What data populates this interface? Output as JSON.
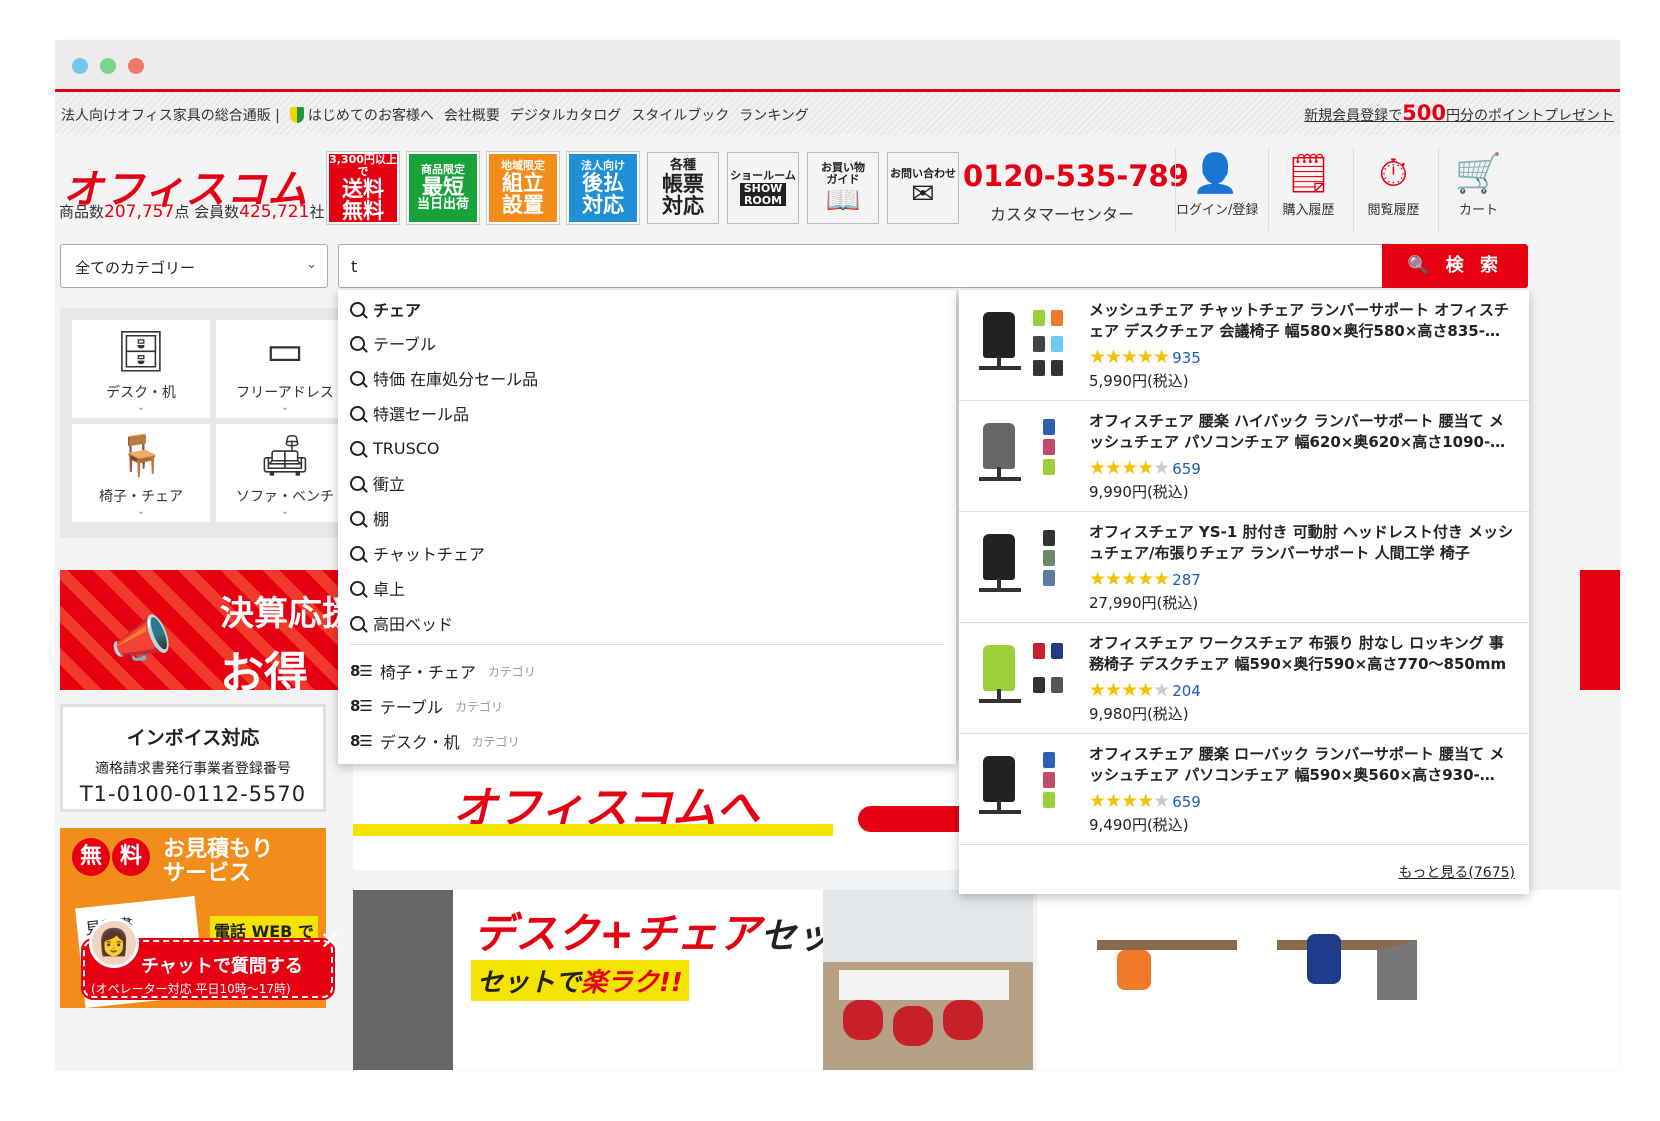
{
  "topnav": {
    "items": [
      "法人向けオフィス家具の総合通販 |",
      "はじめてのお客様へ",
      "会社概要",
      "デジタルカタログ",
      "スタイルブック",
      "ランキング"
    ],
    "promo_pre": "新規会員登録で",
    "promo_num": "500",
    "promo_post": "円分のポイントプレゼント"
  },
  "header": {
    "logo": "オフィスコム",
    "counts_label1": "商品数",
    "counts_num1": "207,757",
    "counts_unit1": "点",
    "counts_label2": "会員数",
    "counts_num2": "425,721",
    "counts_unit2": "社",
    "badges": [
      {
        "small": "3,300円以上で",
        "l1": "送料",
        "l2": "無料"
      },
      {
        "small": "商品限定",
        "l1": "最短",
        "l2": "当日出荷"
      },
      {
        "small": "地域限定",
        "l1": "組立",
        "l2": "設置"
      },
      {
        "small": "法人向け",
        "l1": "後払",
        "l2": "対応"
      },
      {
        "small": "各種",
        "l1": "帳票",
        "l2": "対応"
      },
      {
        "small": "ショールーム",
        "l1": "SHOW",
        "l2": "ROOM"
      },
      {
        "small": "お買い物",
        "l1": "ガイド",
        "l2": ""
      },
      {
        "small": "お問い合わせ",
        "l1": "",
        "l2": ""
      }
    ],
    "phone": "0120-535-789",
    "phone_sub": "カスタマーセンター",
    "icons": [
      {
        "label": "ログイン/登録",
        "icon": "user-icon"
      },
      {
        "label": "購入履歴",
        "icon": "history-list-icon"
      },
      {
        "label": "閲覧履歴",
        "icon": "clock-icon"
      },
      {
        "label": "カート",
        "icon": "cart-icon"
      }
    ]
  },
  "search": {
    "category": "全てのカテゴリー",
    "query": "t",
    "button": "検 索"
  },
  "suggestions": [
    "チェア",
    "テーブル",
    "特価 在庫処分セール品",
    "特選セール品",
    "TRUSCO",
    "衝立",
    "棚",
    "チャットチェア",
    "卓上",
    "高田ベッド"
  ],
  "category_suggestions": [
    {
      "label": "椅子・チェア",
      "tag": "カテゴリ"
    },
    {
      "label": "テーブル",
      "tag": "カテゴリ"
    },
    {
      "label": "デスク・机",
      "tag": "カテゴリ"
    }
  ],
  "products": [
    {
      "title": "メッシュチェア チャットチェア ランバーサポート オフィスチェア デスクチェア 会議椅子 幅580×奥行580×高さ835-…",
      "stars": 4.5,
      "reviews": "935",
      "price": "5,990円(税込)"
    },
    {
      "title": "オフィスチェア 腰楽 ハイバック ランバーサポート 腰当て メッシュチェア パソコンチェア 幅620×奥620×高さ1090-…",
      "stars": 4.0,
      "reviews": "659",
      "price": "9,990円(税込)"
    },
    {
      "title": "オフィスチェア YS-1 肘付き 可動肘 ヘッドレスト付き メッシュチェア/布張りチェア ランバーサポート 人間工学 椅子",
      "stars": 4.5,
      "reviews": "287",
      "price": "27,990円(税込)"
    },
    {
      "title": "オフィスチェア ワークスチェア 布張り 肘なし ロッキング 事務椅子 デスクチェア 幅590×奥行590×高さ770〜850mm",
      "stars": 4.0,
      "reviews": "204",
      "price": "9,980円(税込)"
    },
    {
      "title": "オフィスチェア 腰楽 ローバック ランバーサポート 腰当て メッシュチェア パソコンチェア 幅590×奥560×高さ930-…",
      "stars": 4.0,
      "reviews": "659",
      "price": "9,490円(税込)"
    }
  ],
  "products_more": "もっと見る(7675)",
  "categories": [
    {
      "label": "デスク・机"
    },
    {
      "label": "フリーアドレス"
    },
    {
      "label": "椅子・チェア"
    },
    {
      "label": "ソファ・ベンチ"
    }
  ],
  "banners": {
    "campaign_line1": "決算応援",
    "campaign_line2": "お得",
    "invoice_title": "インボイス対応",
    "invoice_sub": "適格請求書発行事業者登録番号",
    "invoice_num": "T1-0100-0112-5570",
    "estimate_mark1": "無",
    "estimate_mark2": "料",
    "estimate_title": "お見積もり",
    "estimate_title2": "サービス",
    "estimate_paper": "見積書",
    "estimate_sub": "電話 WEB で",
    "chat_title": "チャットで質問する",
    "chat_sub": "(オペレーター対応 平日10時〜17時)",
    "mid_text": "オフィスコムへ",
    "set_title": "デスク+チェア",
    "set_title2": "セット",
    "set_sub_pre": "セットで",
    "set_sub_em": "楽ラク!!"
  }
}
